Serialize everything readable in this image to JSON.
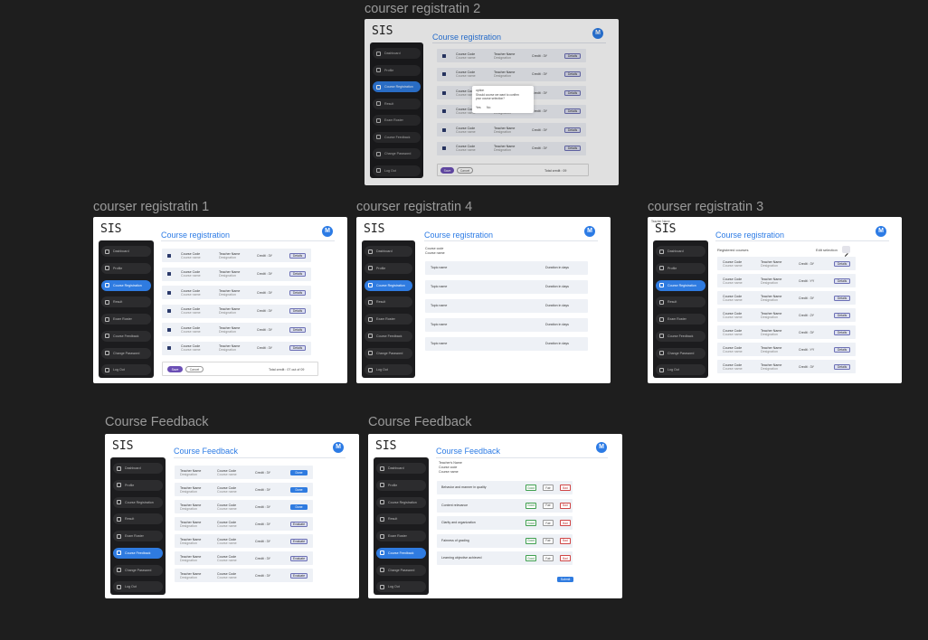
{
  "app": {
    "brand": "SIS",
    "avatar_letter": "M"
  },
  "sidebar": {
    "items": [
      "Dashboard",
      "Profile",
      "Course Registration",
      "Result",
      "Exam Roster",
      "Course Feedback",
      "Change Password",
      "Log Out"
    ]
  },
  "frames": {
    "reg2": {
      "title": "courser registratin 2",
      "heading": "Course registration",
      "dialog": {
        "title": "option",
        "message": "Should course we want to confirm your course selection?",
        "yes": "Yes",
        "no": "No"
      },
      "footer": {
        "save": "Save",
        "cancel": "Cancel",
        "total": "Total credit : 09"
      }
    },
    "reg1": {
      "title": "courser registratin 1",
      "heading": "Course registration",
      "footer": {
        "save": "Save",
        "cancel": "Cancel",
        "total": "Total credit : 07 out of 09"
      }
    },
    "reg4": {
      "title": "courser registratin 4",
      "heading": "Course registration",
      "course_code": "Course code",
      "course_name": "Course name",
      "topics": [
        {
          "name": "Topic name",
          "duration": "Duration in days"
        },
        {
          "name": "Topic name",
          "duration": "Duration in days"
        },
        {
          "name": "Topic name",
          "duration": "Duration in days"
        },
        {
          "name": "Topic name",
          "duration": "Duration in days"
        },
        {
          "name": "Topic name",
          "duration": "Duration in days"
        }
      ]
    },
    "reg3": {
      "title": "courser registratin 3",
      "heading": "Course registration",
      "teacher_name_top": "Teacher Name",
      "registered": "Registered courses",
      "edit": "Edit selection"
    },
    "fb1": {
      "title": "Course Feedback",
      "heading": "Course Feedback"
    },
    "fb2": {
      "title": "Course Feedback",
      "heading": "Course Feedback",
      "meta": [
        "Teacher's Name",
        "Course code",
        "Course name"
      ],
      "questions": [
        "Behavior and manner in quality",
        "Content relevance",
        "Clarity and organization",
        "Fairness of grading",
        "Learning objective achieved"
      ],
      "ratings": {
        "good": "Good",
        "fair": "Fair",
        "bad": "Bad"
      },
      "submit": "Submit"
    }
  },
  "course_row": {
    "code": "Course Code",
    "name": "Course name",
    "teacher": "Teacher Name",
    "designation": "Designation",
    "details": "Details",
    "credits": [
      "Credit : 3Y",
      "Credit : 3Y",
      "Credit : 3Y",
      "Credit : 3Y",
      "Credit : 3Y",
      "Credit : 3Y"
    ],
    "credits_reg3": [
      "Credit : 3Y",
      "Credit : YY",
      "Credit : 3Y",
      "Credit : 2Y",
      "Credit : 3Y",
      "Credit : YY",
      "Credit : 3Y"
    ]
  },
  "feedback_rows": {
    "teacher": "Teacher Name",
    "designation": "Designation",
    "code": "Course Code",
    "name": "Course name",
    "credits": [
      "Credit : 3Y",
      "Credit : 3Y",
      "Credit : 3Y",
      "Credit : 3Y",
      "Credit : 3Y",
      "Credit : 3Y",
      "Credit : 3Y"
    ],
    "actions": [
      "Done",
      "Done",
      "Done",
      "Evaluate",
      "Evaluate",
      "Evaluate",
      "Evaluate"
    ]
  }
}
